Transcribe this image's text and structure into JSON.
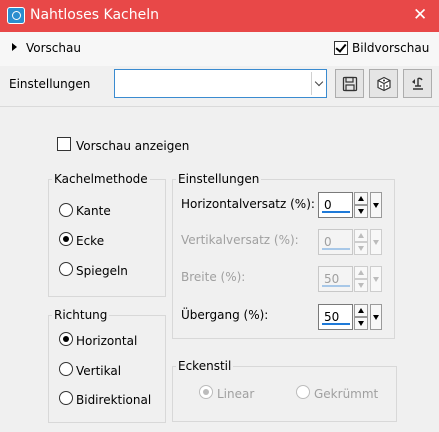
{
  "window": {
    "title": "Nahtloses Kacheln",
    "close_glyph": "✕"
  },
  "preview_section": {
    "label": "Vorschau",
    "image_preview_label": "Bildvorschau",
    "image_preview_checked": true
  },
  "settings_row": {
    "label": "Einstellungen",
    "preset_value": "",
    "buttons": [
      "save-icon",
      "randomize-icon",
      "reset-icon"
    ]
  },
  "show_preview": {
    "label": "Vorschau anzeigen",
    "checked": false
  },
  "tiling_method": {
    "title": "Kachelmethode",
    "options": [
      {
        "label": "Kante",
        "checked": false
      },
      {
        "label": "Ecke",
        "checked": true
      },
      {
        "label": "Spiegeln",
        "checked": false
      }
    ]
  },
  "direction": {
    "title": "Richtung",
    "options": [
      {
        "label": "Horizontal",
        "checked": true
      },
      {
        "label": "Vertikal",
        "checked": false
      },
      {
        "label": "Bidirektional",
        "checked": false
      }
    ]
  },
  "settings_group": {
    "title": "Einstellungen",
    "fields": [
      {
        "label": "Horizontalversatz (%):",
        "value": "0",
        "enabled": true
      },
      {
        "label": "Vertikalversatz (%):",
        "value": "0",
        "enabled": false
      },
      {
        "label": "Breite (%):",
        "value": "50",
        "enabled": false
      },
      {
        "label": "Übergang (%):",
        "value": "50",
        "enabled": true
      }
    ]
  },
  "corner_style": {
    "title": "Eckenstil",
    "options": [
      {
        "label": "Linear",
        "checked": true,
        "enabled": false
      },
      {
        "label": "Gekrümmt",
        "checked": false,
        "enabled": false
      }
    ]
  },
  "colors": {
    "titlebar": "#e84848",
    "accent": "#1f7ad8"
  }
}
